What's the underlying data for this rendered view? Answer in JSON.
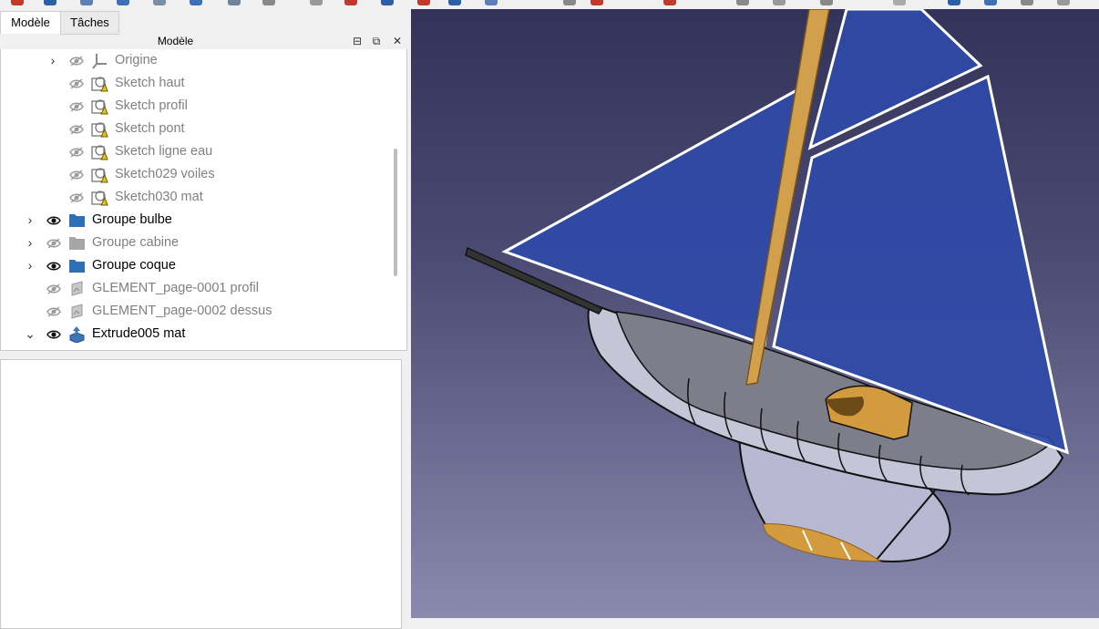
{
  "tabs": {
    "model_label": "Modèle",
    "tasks_label": "Tâches"
  },
  "panel": {
    "title": "Modèle",
    "float_icon": "⊟",
    "restore_icon": "⧉",
    "close_icon": "✕"
  },
  "tree": {
    "items": [
      {
        "label": "Origine",
        "expand": "›",
        "icon": "origin-axes-icon",
        "visible": false
      },
      {
        "label": "Sketch haut",
        "expand": "",
        "icon": "sketch-icon",
        "visible": false
      },
      {
        "label": "Sketch profil",
        "expand": "",
        "icon": "sketch-icon",
        "visible": false
      },
      {
        "label": "Sketch pont",
        "expand": "",
        "icon": "sketch-icon",
        "visible": false
      },
      {
        "label": "Sketch ligne eau",
        "expand": "",
        "icon": "sketch-icon",
        "visible": false
      },
      {
        "label": "Sketch029 voiles",
        "expand": "",
        "icon": "sketch-icon",
        "visible": false
      },
      {
        "label": "Sketch030 mat",
        "expand": "",
        "icon": "sketch-icon",
        "visible": false
      },
      {
        "label": "Groupe bulbe",
        "expand": "›",
        "icon": "folder-icon",
        "visible": true
      },
      {
        "label": "Groupe cabine",
        "expand": "›",
        "icon": "folder-icon",
        "visible": false
      },
      {
        "label": "Groupe coque",
        "expand": "›",
        "icon": "folder-icon",
        "visible": true
      },
      {
        "label": "GLEMENT_page-0001 profil",
        "expand": "",
        "icon": "image-plane-icon",
        "visible": false
      },
      {
        "label": "GLEMENT_page-0002 dessus",
        "expand": "",
        "icon": "image-plane-icon",
        "visible": false
      },
      {
        "label": "Extrude005 mat",
        "expand": "⌄",
        "icon": "extrude-icon",
        "visible": true
      }
    ]
  },
  "colors": {
    "folder": "#2f6fb7",
    "folder_disabled": "#a6a6a6",
    "sail": "#2f4aa8",
    "hull": "#c5c5d8",
    "mast": "#d2a04c",
    "viewport_top": "#33335a",
    "viewport_bottom": "#8a8aae"
  }
}
